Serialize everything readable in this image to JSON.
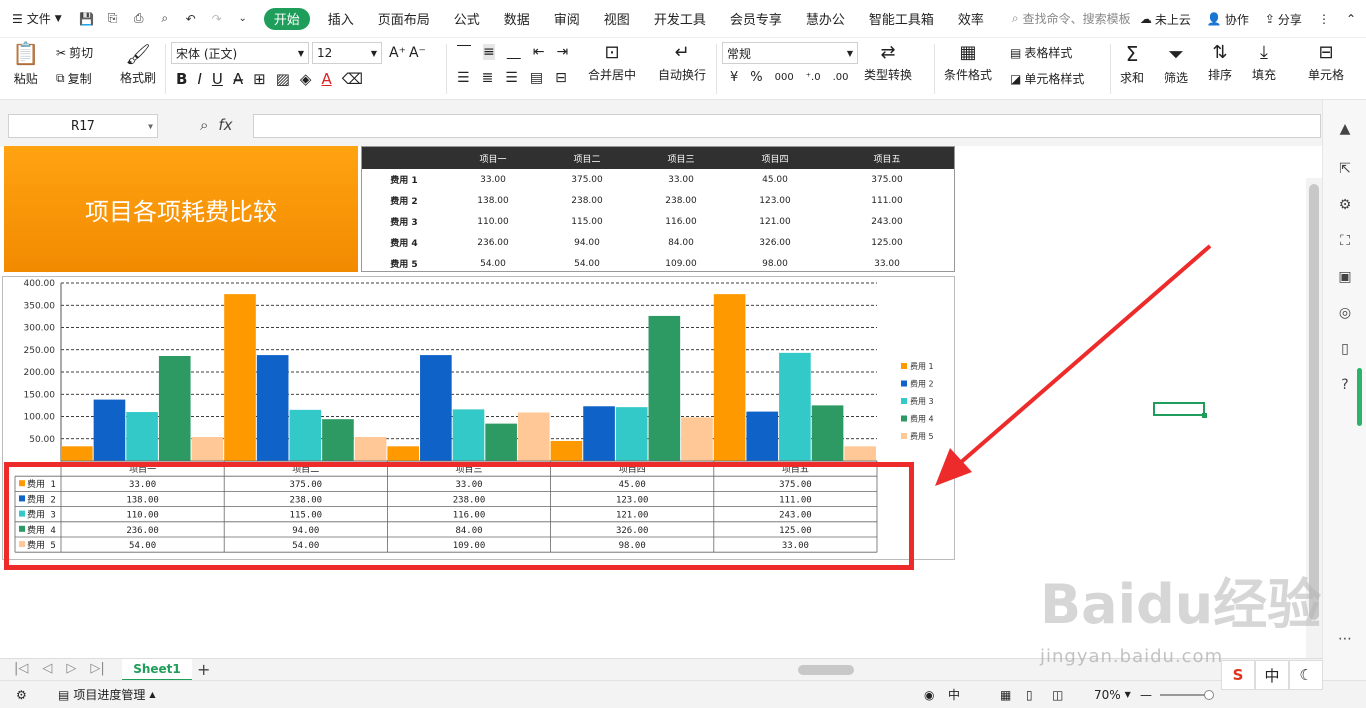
{
  "menubar": {
    "file_label": "文件",
    "tabs": [
      "开始",
      "插入",
      "页面布局",
      "公式",
      "数据",
      "审阅",
      "视图",
      "开发工具",
      "会员专享",
      "慧办公",
      "智能工具箱",
      "效率"
    ],
    "active_tab": "开始",
    "search_placeholder": "查找命令、搜索模板",
    "cloud": "未上云",
    "collab": "协作",
    "share": "分享"
  },
  "ribbon": {
    "paste": "粘贴",
    "cut": "剪切",
    "copy": "复制",
    "format_painter": "格式刷",
    "font_name": "宋体 (正文)",
    "font_size": "12",
    "bold": "B",
    "italic": "I",
    "underline": "U",
    "merge_center": "合并居中",
    "wrap_text": "自动换行",
    "number_format": "常规",
    "type_convert": "类型转换",
    "conditional_format": "条件格式",
    "table_style": "表格样式",
    "cell_style": "单元格样式",
    "sum": "求和",
    "filter": "筛选",
    "sort": "排序",
    "fill": "填充",
    "cell": "单元格",
    "currency": "¥",
    "percent": "%",
    "thousands": "000"
  },
  "formula": {
    "cell_ref": "R17",
    "fx": "fx",
    "value": ""
  },
  "sheet": {
    "title": "项目各项耗费比较",
    "projects": [
      "项目一",
      "项目二",
      "项目三",
      "项目四",
      "项目五"
    ],
    "rows": [
      {
        "label": "费用 1",
        "values": [
          "33.00",
          "375.00",
          "33.00",
          "45.00",
          "375.00"
        ]
      },
      {
        "label": "费用 2",
        "values": [
          "138.00",
          "238.00",
          "238.00",
          "123.00",
          "111.00"
        ]
      },
      {
        "label": "费用 3",
        "values": [
          "110.00",
          "115.00",
          "116.00",
          "121.00",
          "243.00"
        ]
      },
      {
        "label": "费用 4",
        "values": [
          "236.00",
          "94.00",
          "84.00",
          "326.00",
          "125.00"
        ]
      },
      {
        "label": "费用 5",
        "values": [
          "54.00",
          "54.00",
          "109.00",
          "98.00",
          "33.00"
        ]
      }
    ]
  },
  "chart_data": {
    "type": "bar",
    "categories": [
      "项目一",
      "项目二",
      "项目三",
      "项目四",
      "项目五"
    ],
    "series": [
      {
        "name": "费用 1",
        "color": "#ff9900",
        "values": [
          33,
          375,
          33,
          45,
          375
        ]
      },
      {
        "name": "费用 2",
        "color": "#0f62c8",
        "values": [
          138,
          238,
          238,
          123,
          111
        ]
      },
      {
        "name": "费用 3",
        "color": "#33c9c9",
        "values": [
          110,
          115,
          116,
          121,
          243
        ]
      },
      {
        "name": "费用 4",
        "color": "#2e9a63",
        "values": [
          236,
          94,
          84,
          326,
          125
        ]
      },
      {
        "name": "费用 5",
        "color": "#ffc896",
        "values": [
          54,
          54,
          109,
          98,
          33
        ]
      }
    ],
    "yticks": [
      "50.00",
      "100.00",
      "150.00",
      "200.00",
      "250.00",
      "300.00",
      "350.00",
      "400.00"
    ],
    "ylim": [
      0,
      400
    ],
    "grid": true,
    "legend": "right",
    "data_table": true
  },
  "tabs": {
    "sheet_name": "Sheet1"
  },
  "status": {
    "doc_name": "项目进度管理",
    "zoom": "70%"
  },
  "watermark": {
    "logo": "Baidu经验",
    "url": "jingyan.baidu.com"
  },
  "ime": [
    "中"
  ]
}
